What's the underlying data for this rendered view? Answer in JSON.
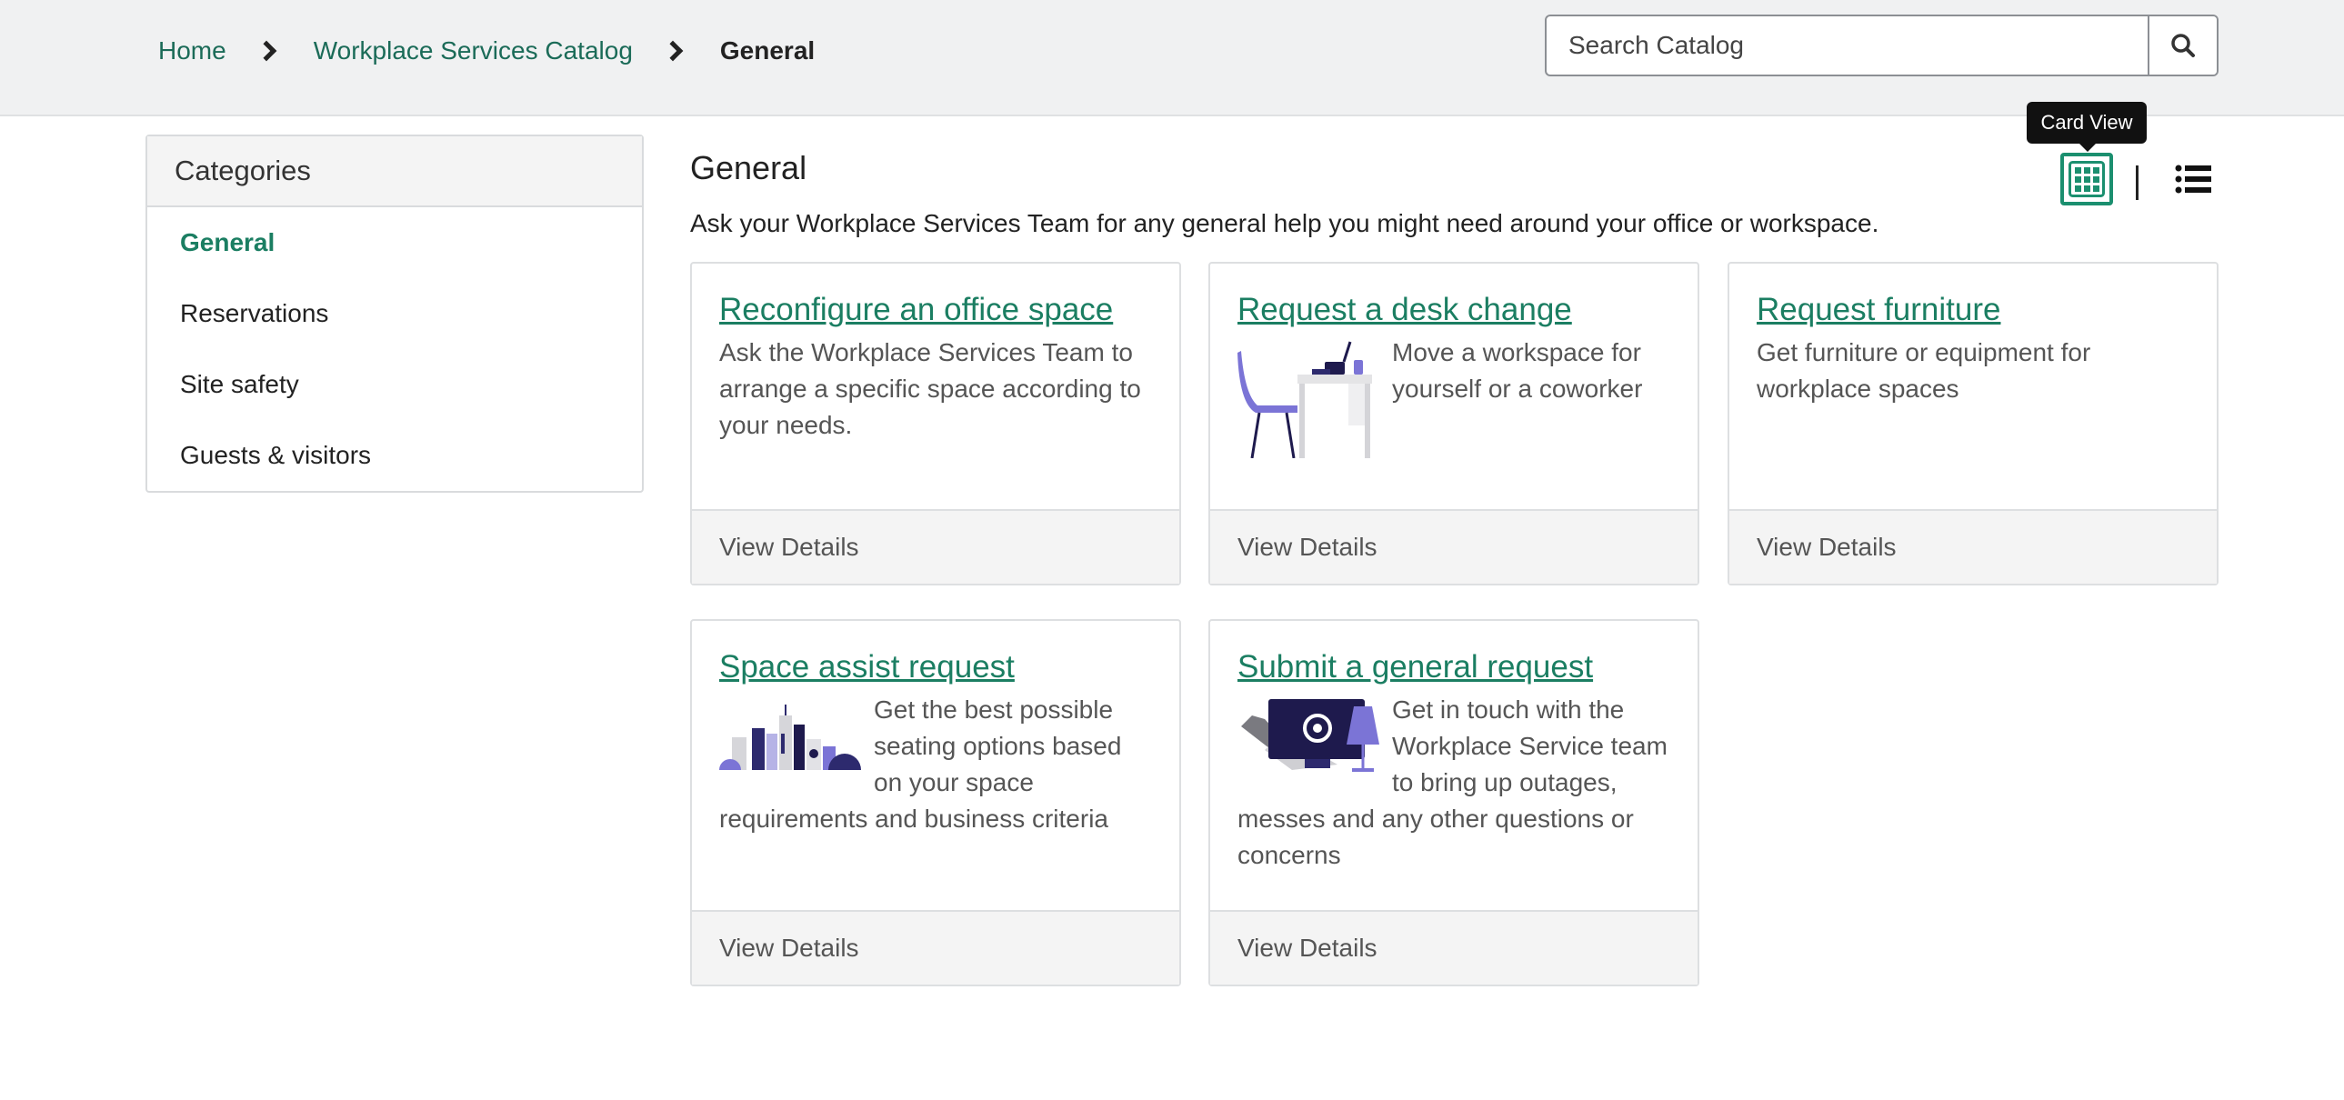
{
  "breadcrumb": {
    "home": "Home",
    "catalog": "Workplace Services Catalog",
    "current": "General"
  },
  "search": {
    "placeholder": "Search Catalog",
    "icon": "search-icon"
  },
  "sidebar": {
    "title": "Categories",
    "items": [
      {
        "label": "General",
        "active": true
      },
      {
        "label": "Reservations"
      },
      {
        "label": "Site safety"
      },
      {
        "label": "Guests & visitors"
      }
    ]
  },
  "main": {
    "title": "General",
    "description": "Ask your Workplace Services Team for any general help you might need around your office or workspace.",
    "tooltip": "Card View",
    "card_view_icon": "grid-icon",
    "list_view_icon": "list-icon"
  },
  "cards": [
    {
      "title": "Reconfigure an office space",
      "text": "Ask the Workplace Services Team to arrange a specific space according to your needs.",
      "footer": "View Details"
    },
    {
      "title": "Request a desk change",
      "text": "Move a workspace for yourself or a coworker",
      "footer": "View Details",
      "image": "desk-chair-illustration"
    },
    {
      "title": "Request furniture",
      "text": "Get furniture or equipment for workplace spaces",
      "footer": "View Details"
    },
    {
      "title": "Space assist request",
      "text": "Get the best possible seating options based on your space requirements and business criteria",
      "footer": "View Details",
      "image": "city-skyline-illustration"
    },
    {
      "title": "Submit a general request",
      "text": "Get in touch with the Workplace Service team to bring up outages, messes and any other questions or concerns",
      "footer": "View Details",
      "image": "monitor-lamp-illustration"
    }
  ],
  "colors": {
    "accent": "#1b7e62",
    "illustration_purple": "#7b74d6",
    "illustration_navy": "#1e1a4d"
  }
}
